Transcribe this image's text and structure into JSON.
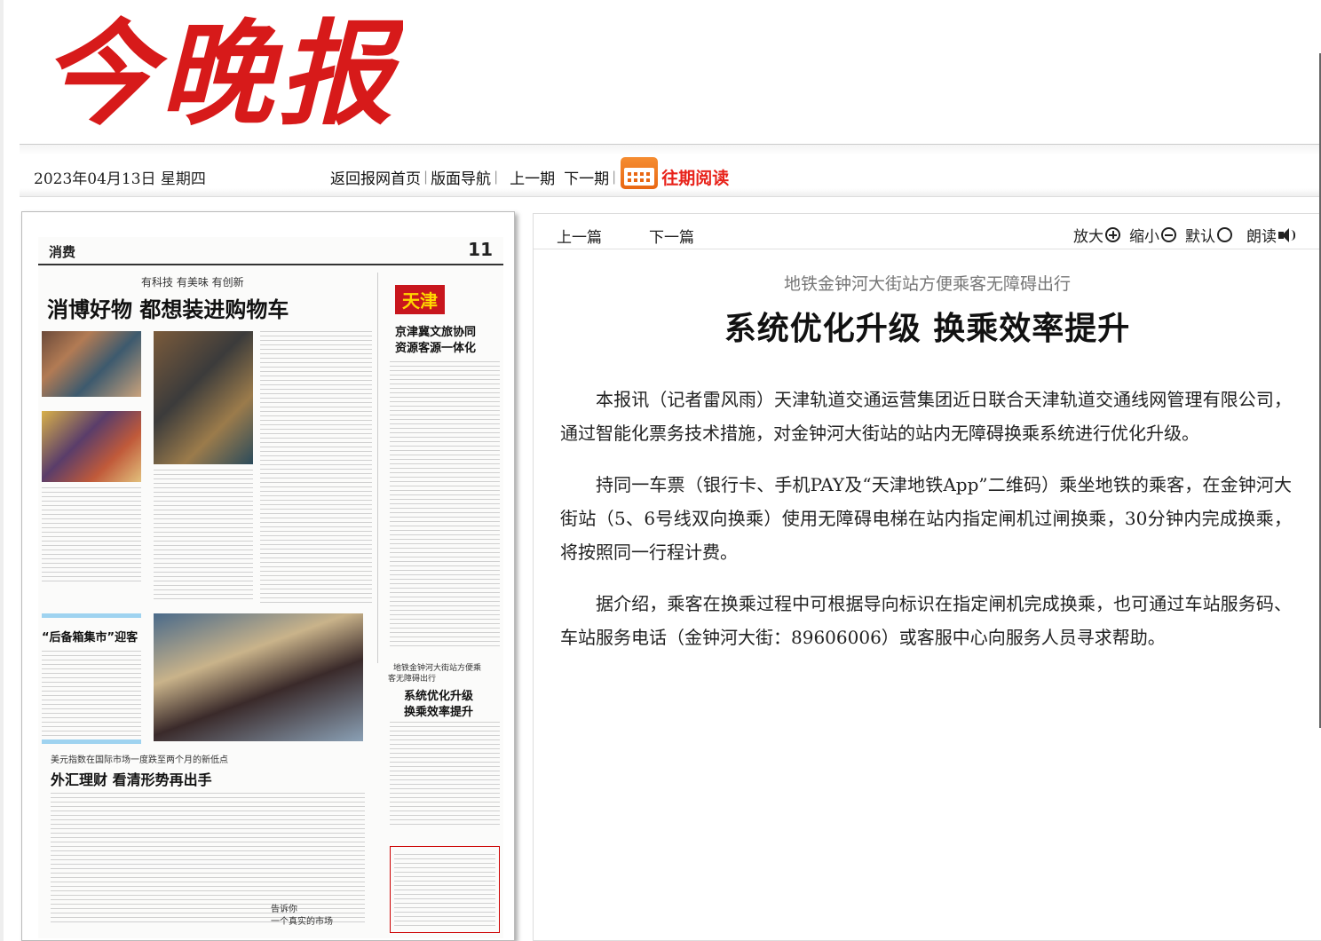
{
  "masthead": {
    "logo_text": "今晚报"
  },
  "topbar": {
    "date": "2023年04月13日 星期四",
    "nav": [
      {
        "label": "返回报网首页"
      },
      {
        "label": "版面导航"
      },
      {
        "label": "上一期"
      },
      {
        "label": "下一期"
      }
    ],
    "archive_label": "往期阅读"
  },
  "page_thumbnail": {
    "section": "消费",
    "page_number": "11",
    "kicker": "有科技 有美味 有创新",
    "headline": "消博好物 都想装进购物车",
    "side_tag": "天津",
    "side_headline_1": "京津冀文旅协同",
    "side_headline_2": "资源客源一体化",
    "story2": "“后备箱集市”迎客",
    "story3_kicker": "美元指数在国际市场一度跌至两个月的新低点",
    "story3_headline": "外汇理财 看清形势再出手",
    "story4_kicker_1": "地铁金钟河大街站方便乘",
    "story4_kicker_2": "客无障碍出行",
    "story4_headline_1": "系统优化升级",
    "story4_headline_2": "换乘效率提升",
    "promo_1": "告诉你",
    "promo_2": "一个真实的市场"
  },
  "article_tools": {
    "prev": "上一篇",
    "next": "下一篇",
    "zoom_in": "放大",
    "zoom_out": "缩小",
    "default": "默认",
    "read_aloud": "朗读"
  },
  "article": {
    "subtitle": "地铁金钟河大街站方便乘客无障碍出行",
    "title": "系统优化升级 换乘效率提升",
    "paragraphs": [
      "本报讯（记者雷风雨）天津轨道交通运营集团近日联合天津轨道交通线网管理有限公司，通过智能化票务技术措施，对金钟河大街站的站内无障碍换乘系统进行优化升级。",
      "持同一车票（银行卡、手机PAY及“天津地铁App”二维码）乘坐地铁的乘客，在金钟河大街站（5、6号线双向换乘）使用无障碍电梯在站内指定闸机过闸换乘，30分钟内完成换乘，将按照同一行程计费。",
      "据介绍，乘客在换乘过程中可根据导向标识在指定闸机完成换乘，也可通过车站服务码、车站服务电话（金钟河大街：89606006）或客服中心向服务人员寻求帮助。"
    ]
  },
  "colors": {
    "brand_red": "#d71a1a",
    "archive_orange": "#e96713"
  }
}
